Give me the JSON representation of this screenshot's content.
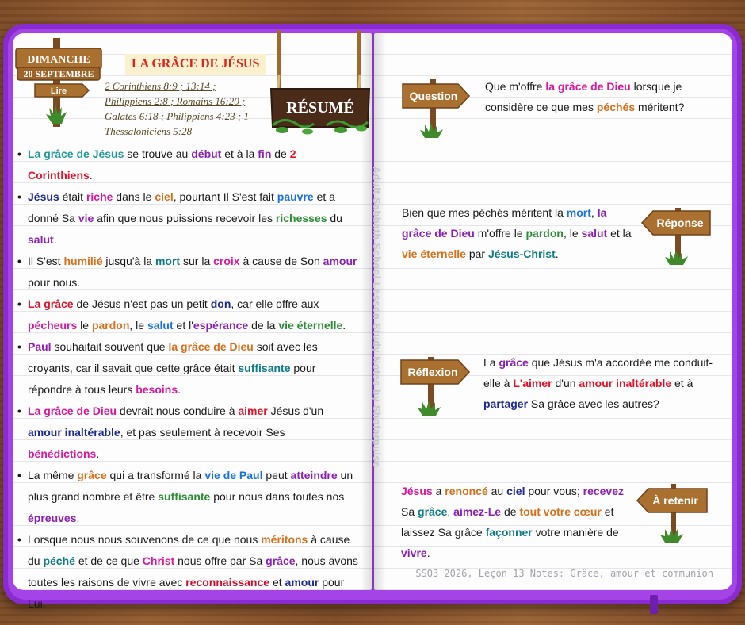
{
  "day_sign": {
    "day": "DIMANCHE",
    "date": "20 SEPTEMBRE",
    "read": "Lire"
  },
  "title": "LA GRÂCE DE JÉSUS",
  "references": [
    "2 Corinthiens 8:9 ; 13:14 ;",
    "Philippiens 2:8 ; Romains 16:20 ;",
    "Galates 6:18 ; Philippiens 4:23 ; 1",
    "Thessaloniciens 5:28"
  ],
  "summary_sign": "RÉSUMÉ",
  "bullets": [
    [
      [
        "La grâce de Jésus",
        "c-teal"
      ],
      [
        " se trouve au ",
        ""
      ],
      [
        "début",
        "c-purple"
      ],
      [
        " et à la ",
        ""
      ],
      [
        "fin",
        "c-purple"
      ],
      [
        " de ",
        ""
      ],
      [
        "2 Corinthiens",
        "c-red"
      ],
      [
        ".",
        ""
      ]
    ],
    [
      [
        "Jésus",
        "c-navy"
      ],
      [
        " était ",
        ""
      ],
      [
        "riche",
        "c-mag"
      ],
      [
        " dans le ",
        ""
      ],
      [
        "ciel",
        "c-orange"
      ],
      [
        ", pourtant Il S'est fait ",
        ""
      ],
      [
        "pauvre",
        "c-blue"
      ],
      [
        " et a donné Sa ",
        ""
      ],
      [
        "vie",
        "c-purple"
      ],
      [
        " afin que nous puissions recevoir les ",
        ""
      ],
      [
        "richesses",
        "c-green"
      ],
      [
        " du ",
        ""
      ],
      [
        "salut",
        "c-purple"
      ],
      [
        ".",
        ""
      ]
    ],
    [
      [
        "Il S'est ",
        ""
      ],
      [
        "humilié",
        "c-orange"
      ],
      [
        " jusqu'à la ",
        ""
      ],
      [
        "mort",
        "c-dteal"
      ],
      [
        " sur la ",
        ""
      ],
      [
        "croix",
        "c-mag"
      ],
      [
        " à cause de Son ",
        ""
      ],
      [
        "amour",
        "c-purple"
      ],
      [
        " pour nous.",
        ""
      ]
    ],
    [
      [
        "La grâce",
        "c-red"
      ],
      [
        " de Jésus n'est pas un petit ",
        ""
      ],
      [
        "don",
        "c-navy"
      ],
      [
        ", car elle offre aux ",
        ""
      ],
      [
        "pécheurs",
        "c-mag"
      ],
      [
        " le ",
        ""
      ],
      [
        "pardon",
        "c-orange"
      ],
      [
        ", le ",
        ""
      ],
      [
        "salut",
        "c-blue"
      ],
      [
        " et l'",
        ""
      ],
      [
        "espérance",
        "c-purple"
      ],
      [
        " de la ",
        ""
      ],
      [
        "vie éternelle",
        "c-green"
      ],
      [
        ".",
        ""
      ]
    ],
    [
      [
        "Paul",
        "c-purple"
      ],
      [
        " souhaitait souvent que ",
        ""
      ],
      [
        "la grâce de Dieu",
        "c-orange"
      ],
      [
        " soit avec les croyants, car il savait que cette grâce était ",
        ""
      ],
      [
        "suffisante",
        "c-dteal"
      ],
      [
        " pour répondre à tous leurs ",
        ""
      ],
      [
        "besoins",
        "c-mag"
      ],
      [
        ".",
        ""
      ]
    ],
    [
      [
        "La grâce de Dieu",
        "c-mag"
      ],
      [
        " devrait nous conduire à ",
        ""
      ],
      [
        "aimer",
        "c-red"
      ],
      [
        " Jésus d'un ",
        ""
      ],
      [
        "amour inaltérable",
        "c-navy"
      ],
      [
        ", et pas seulement à recevoir Ses ",
        ""
      ],
      [
        "bénédictions",
        "c-mag"
      ],
      [
        ".",
        ""
      ]
    ],
    [
      [
        "La même ",
        ""
      ],
      [
        "grâce",
        "c-orange"
      ],
      [
        " qui a transformé la ",
        ""
      ],
      [
        "vie de Paul",
        "c-blue"
      ],
      [
        " peut ",
        ""
      ],
      [
        "atteindre",
        "c-purple"
      ],
      [
        " un plus grand nombre et être ",
        ""
      ],
      [
        "suffisante",
        "c-green"
      ],
      [
        " pour nous dans toutes nos ",
        ""
      ],
      [
        "épreuves",
        "c-purple"
      ],
      [
        ".",
        ""
      ]
    ],
    [
      [
        "Lorsque nous nous souvenons de ce que nous ",
        ""
      ],
      [
        "méritons",
        "c-orange"
      ],
      [
        " à cause du ",
        ""
      ],
      [
        "péché",
        "c-dteal"
      ],
      [
        " et de ce que ",
        ""
      ],
      [
        "Christ",
        "c-mag"
      ],
      [
        " nous offre par Sa ",
        ""
      ],
      [
        "grâce",
        "c-purple"
      ],
      [
        ", nous avons toutes les raisons de vivre avec ",
        ""
      ],
      [
        "reconnaissance",
        "c-dred"
      ],
      [
        " et ",
        ""
      ],
      [
        "amour",
        "c-navy"
      ],
      [
        " pour Lui.",
        ""
      ]
    ]
  ],
  "watermark": "Adult Sabbath School Lesson Study Notes by Shofarpulse",
  "sections": {
    "question": {
      "label": "Question",
      "text": [
        [
          "Que m'offre ",
          ""
        ],
        [
          "la grâce de Dieu",
          "c-mag"
        ],
        [
          " lorsque je considère ce que mes ",
          ""
        ],
        [
          "péchés",
          "c-orange"
        ],
        [
          " méritent?",
          ""
        ]
      ]
    },
    "reponse": {
      "label": "Réponse",
      "text": [
        [
          "Bien que mes péchés méritent la ",
          ""
        ],
        [
          "mort",
          "c-blue"
        ],
        [
          ", ",
          ""
        ],
        [
          "la grâce de Dieu",
          "c-purple"
        ],
        [
          " m'offre le ",
          ""
        ],
        [
          "pardon",
          "c-green"
        ],
        [
          ", le ",
          ""
        ],
        [
          "salut",
          "c-purple"
        ],
        [
          " et la ",
          ""
        ],
        [
          "vie éternelle",
          "c-orange"
        ],
        [
          " par ",
          ""
        ],
        [
          "Jésus-Christ",
          "c-dteal"
        ],
        [
          ".",
          ""
        ]
      ]
    },
    "reflexion": {
      "label": "Réflexion",
      "text": [
        [
          "La ",
          ""
        ],
        [
          "grâce",
          "c-purple"
        ],
        [
          " que Jésus m'a accordée me conduit-elle à ",
          ""
        ],
        [
          "L'aimer",
          "c-red"
        ],
        [
          " d'un ",
          ""
        ],
        [
          "amour inaltérable",
          "c-red"
        ],
        [
          " et à ",
          ""
        ],
        [
          "partager",
          "c-navy"
        ],
        [
          " Sa grâce avec les autres?",
          ""
        ]
      ]
    },
    "retenir": {
      "label": "À retenir",
      "text": [
        [
          "Jésus",
          "c-mag"
        ],
        [
          " a ",
          ""
        ],
        [
          "renoncé",
          "c-orange"
        ],
        [
          " au ",
          ""
        ],
        [
          "ciel",
          "c-navy"
        ],
        [
          " pour vous; ",
          ""
        ],
        [
          "recevez",
          "c-purple"
        ],
        [
          " Sa ",
          ""
        ],
        [
          "grâce",
          "c-dteal"
        ],
        [
          ", ",
          ""
        ],
        [
          "aimez-Le",
          "c-purple"
        ],
        [
          " de ",
          ""
        ],
        [
          "tout votre cœur",
          "c-orange"
        ],
        [
          " et laissez Sa grâce ",
          ""
        ],
        [
          "façonner",
          "c-dteal"
        ],
        [
          " votre manière de ",
          ""
        ],
        [
          "vivre",
          "c-purple"
        ],
        [
          ".",
          ""
        ]
      ]
    }
  },
  "footer": "SSQ3 2026, Leçon 13 Notes: Grâce, amour et communion",
  "colors": {
    "cover": "#8a2bd1",
    "sign_wood": "#a9702f",
    "sign_text": "#ffffff",
    "title_red": "#d9261c"
  }
}
